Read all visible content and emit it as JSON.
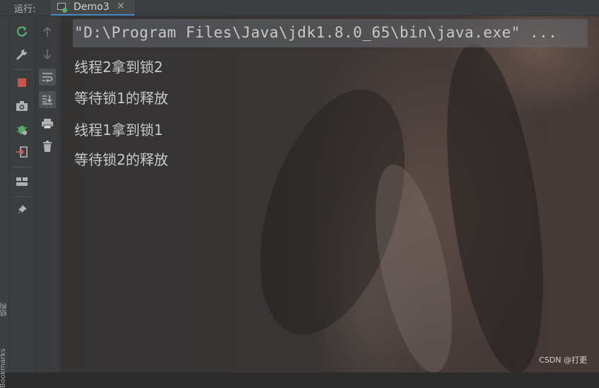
{
  "run_panel": {
    "label": "运行:",
    "tab_title": "Demo3",
    "tab_close": "✕"
  },
  "left_strip": {
    "structure_label": "结构",
    "bookmarks_label": "Bookmarks"
  },
  "toolbar_left": [
    "rerun-icon",
    "wrench-icon",
    "stop-icon",
    "camera-icon",
    "debug-icon",
    "exit-icon",
    "layout-icon",
    "pin-icon"
  ],
  "toolbar_right": [
    "arrow-up-icon",
    "arrow-down-icon",
    "soft-wrap-icon",
    "scroll-to-end-icon",
    "print-icon",
    "trash-icon"
  ],
  "console": {
    "command": "\"D:\\Program Files\\Java\\jdk1.8.0_65\\bin\\java.exe\" ...",
    "lines": [
      "线程2拿到锁2",
      "等待锁1的释放",
      "线程1拿到锁1",
      "等待锁2的释放"
    ]
  },
  "watermark": "CSDN @打更",
  "colors": {
    "accent_tab_underline": "#4a88c7",
    "rerun_green": "#59a869",
    "stop_red": "#c75450"
  }
}
